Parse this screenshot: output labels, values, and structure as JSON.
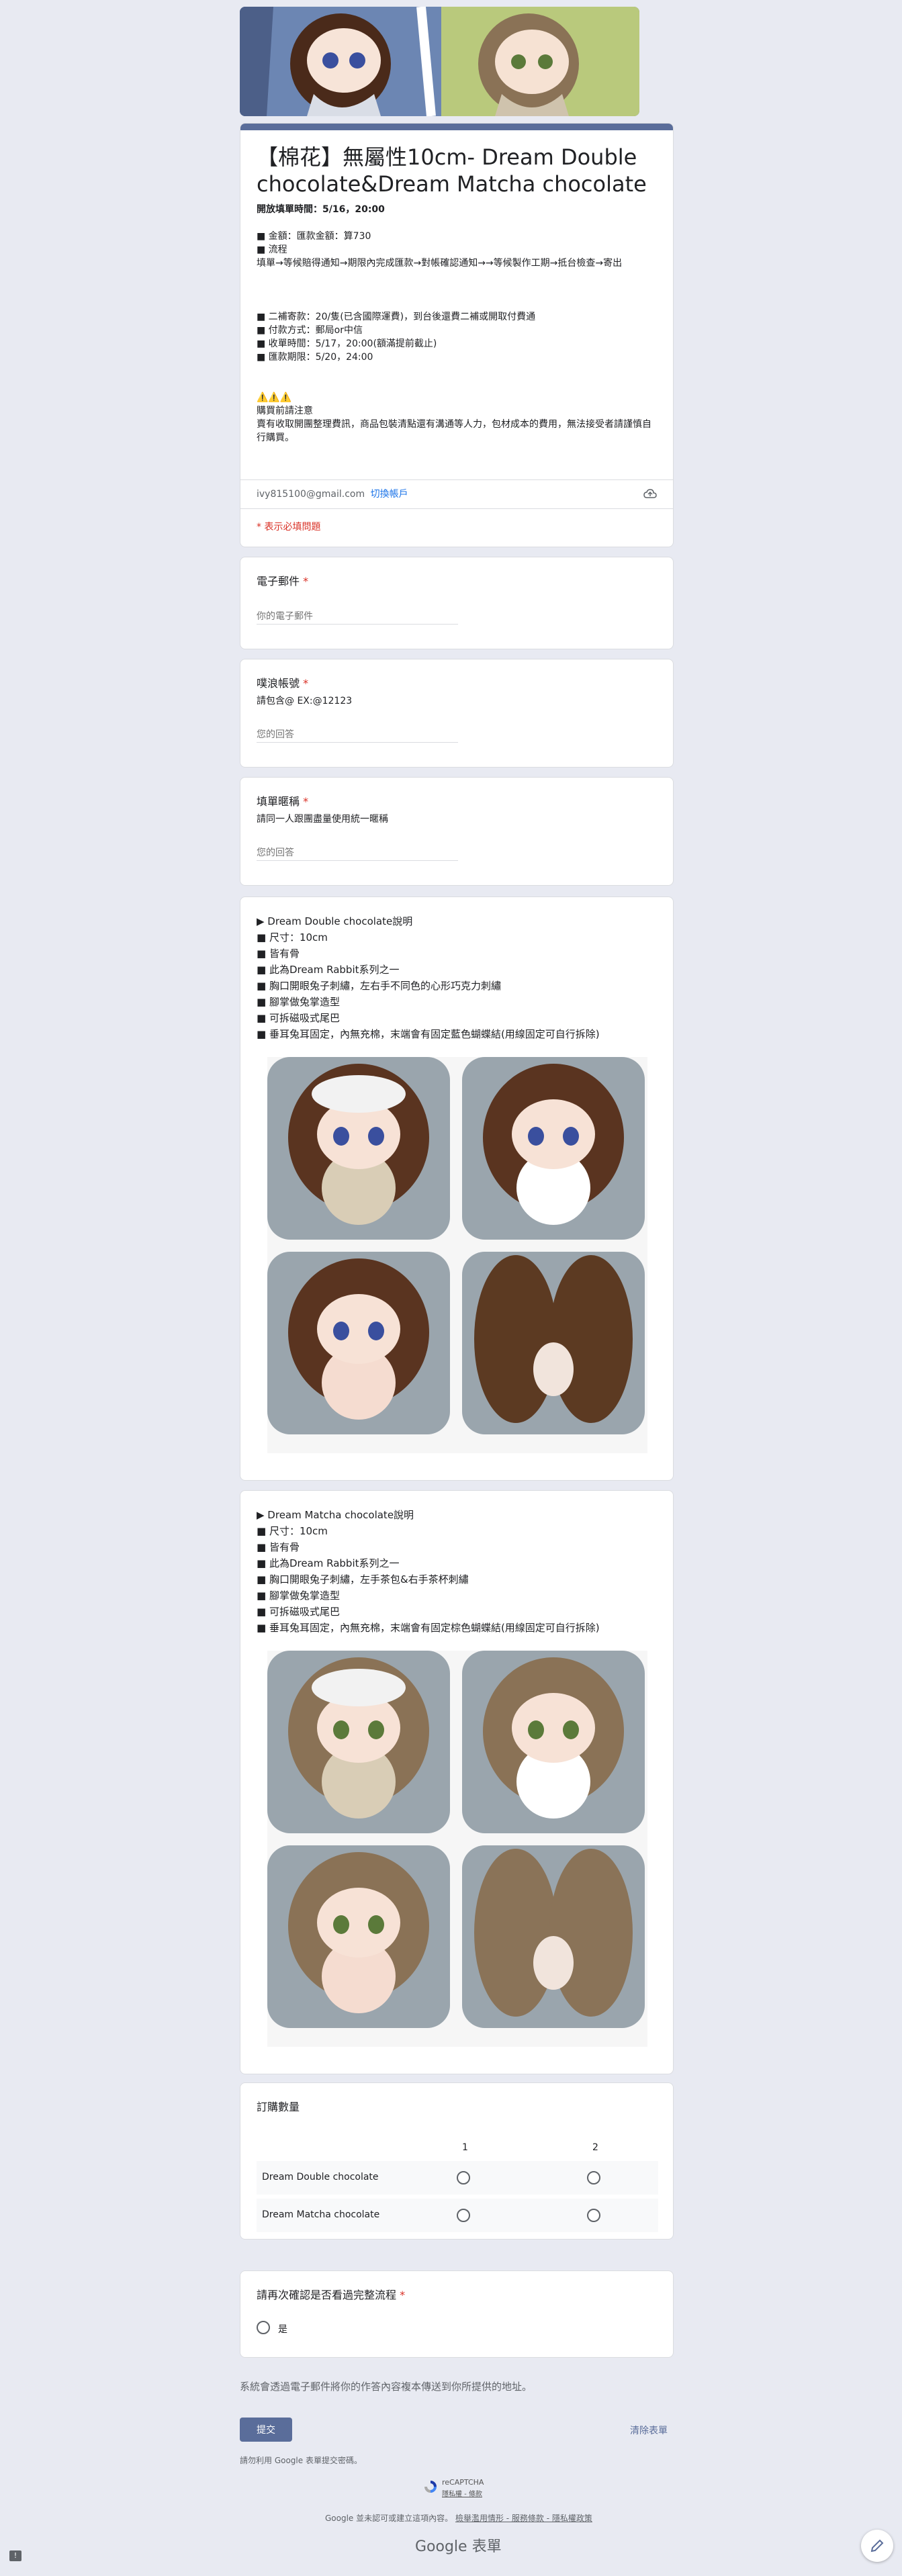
{
  "form": {
    "title": "【棉花】無屬性10cm- Dream Double chocolate&Dream Matcha chocolate",
    "description_lines": [
      "開放填單時間：5/16，20:00",
      "",
      "■ 金額：匯款金額：算730",
      "■ 流程",
      "填單→等候賠得通知→期限內完成匯款→對帳確認通知→→等候製作工期→抵台檢查→寄出",
      "",
      "",
      "",
      "■ 二補寄款：20/隻(已含國際運費)，到台後還費二補或開取付費通",
      "■ 付款方式：郵局or中信",
      "■ 收單時間：5/17，20:00(額滿提前截止)",
      "■ 匯款期限：5/20，24:00",
      "",
      "",
      "⚠️⚠️⚠️",
      "購買前請注意",
      "賣有收取開團整理費訊，商品包裝清點還有溝通等人力，包材成本的費用，無法接受者請謹慎自行購買。"
    ],
    "account_email": "ivy815100@gmail.com",
    "switch_account": "切換帳戶",
    "required_note": "* 表示必填問題"
  },
  "questions": {
    "email": {
      "title": "電子郵件",
      "placeholder": "你的電子郵件"
    },
    "plurk": {
      "title": "噗浪帳號",
      "desc": "請包含@  EX:@12123",
      "placeholder": "您的回答"
    },
    "nickname": {
      "title": "填單暱稱",
      "desc": "請同一人跟團盡量使用統一暱稱",
      "placeholder": "您的回答"
    },
    "confirm": {
      "title": "請再次確認是否看過完整流程",
      "option": "是"
    }
  },
  "products": [
    {
      "title": "▶ Dream Double chocolate說明",
      "lines": [
        "■ 尺寸：10cm",
        "■ 皆有骨",
        "■ 此為Dream Rabbit系列之一",
        "■ 胸口開眼兔子刺繡，左右手不同色的心形巧克力刺繡",
        "■ 腳掌做兔掌造型",
        "■ 可拆磁吸式尾巴",
        "■ 垂耳兔耳固定，內無充棉，末端會有固定藍色蝴蝶結(用線固定可自行拆除)"
      ],
      "hair_color": "#5a3420",
      "ear_color": "#5c3a22",
      "eye_color": "#3a4f9e"
    },
    {
      "title": "▶ Dream Matcha chocolate說明",
      "lines": [
        "■ 尺寸：10cm",
        "■ 皆有骨",
        "■ 此為Dream Rabbit系列之一",
        "■ 胸口開眼兔子刺繡，左手茶包&右手茶杯刺繡",
        "■ 腳掌做兔掌造型",
        "■ 可拆磁吸式尾巴",
        "■ 垂耳兔耳固定，內無充棉，末端會有固定棕色蝴蝶結(用線固定可自行拆除)"
      ],
      "hair_color": "#8a7256",
      "ear_color": "#8a7358",
      "eye_color": "#5b7a3a"
    }
  ],
  "order_grid": {
    "title": "訂購數量",
    "columns": [
      "1",
      "2"
    ],
    "rows": [
      "Dream Double chocolate",
      "Dream Matcha chocolate"
    ]
  },
  "footer": {
    "copy_note": "系統會透過電子郵件將你的作答內容複本傳送到你所提供的地址。",
    "submit": "提交",
    "clear": "清除表單",
    "password_note": "請勿利用 Google 表單提交密碼。",
    "recaptcha_label": "reCAPTCHA",
    "recaptcha_links": "隱私權 - 條款",
    "disclaimer": "Google 並未認可或建立這項內容。",
    "report_links": "檢舉濫用情形 - 服務條款 - 隱私權政策",
    "brand": "Google 表單"
  },
  "colors": {
    "accent": "#5a6d9a",
    "required": "#d93025",
    "link": "#1a73e8"
  }
}
